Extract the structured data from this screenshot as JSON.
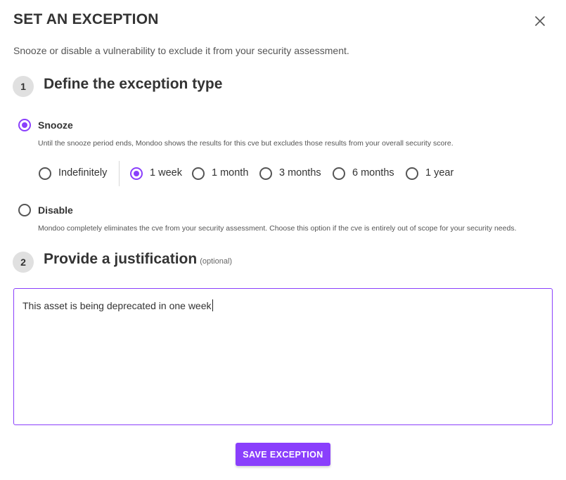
{
  "dialog": {
    "title": "SET AN EXCEPTION",
    "subtitle": "Snooze or disable a vulnerability to exclude it from your security assessment.",
    "close_icon": "close-icon"
  },
  "step1": {
    "number": "1",
    "heading": "Define the exception type"
  },
  "options": {
    "snooze": {
      "label": "Snooze",
      "description": "Until the snooze period ends, Mondoo shows the results for this cve but excludes those results from your overall security score.",
      "selected": true
    },
    "durations": [
      {
        "label": "Indefinitely",
        "selected": false
      },
      {
        "label": "1 week",
        "selected": true
      },
      {
        "label": "1 month",
        "selected": false
      },
      {
        "label": "3 months",
        "selected": false
      },
      {
        "label": "6 months",
        "selected": false
      },
      {
        "label": "1 year",
        "selected": false
      }
    ],
    "disable": {
      "label": "Disable",
      "description": "Mondoo completely eliminates the cve from your security assessment. Choose this option if the cve is entirely out of scope for your security needs.",
      "selected": false
    }
  },
  "step2": {
    "number": "2",
    "heading": "Provide a justification",
    "optional": "(optional)"
  },
  "justification": {
    "value": "This asset is being deprecated in one week"
  },
  "actions": {
    "save_label": "SAVE EXCEPTION"
  },
  "colors": {
    "accent": "#8a3ffc",
    "step_circle": "#e0e0e0"
  }
}
